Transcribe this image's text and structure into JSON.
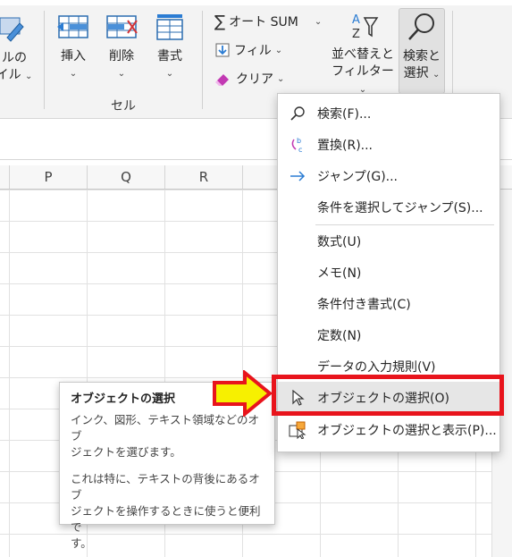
{
  "ribbon": {
    "fill_style_label_line1": "ルの",
    "fill_style_label_line2": "イル",
    "insert_label": "挿入",
    "delete_label": "削除",
    "format_label": "書式",
    "cells_group_label": "セル",
    "autosum_label": "オート SUM",
    "fill_label": "フィル",
    "clear_label": "クリア",
    "sort_filter_line1": "並べ替えと",
    "sort_filter_line2": "フィルター",
    "find_select_line1": "検索と",
    "find_select_line2": "選択"
  },
  "columns": [
    "P",
    "Q",
    "R"
  ],
  "menu": {
    "items": [
      {
        "label": "検索(F)...",
        "icon": "search-icon"
      },
      {
        "label": "置換(R)...",
        "icon": "replace-icon"
      },
      {
        "label": "ジャンプ(G)...",
        "icon": "arrow-right-icon"
      },
      {
        "label": "条件を選択してジャンプ(S)...",
        "icon": ""
      },
      {
        "label": "数式(U)",
        "icon": ""
      },
      {
        "label": "メモ(N)",
        "icon": ""
      },
      {
        "label": "条件付き書式(C)",
        "icon": ""
      },
      {
        "label": "定数(N)",
        "icon": ""
      },
      {
        "label": "データの入力規則(V)",
        "icon": ""
      },
      {
        "label": "オブジェクトの選択(O)",
        "icon": "cursor-icon"
      },
      {
        "label": "オブジェクトの選択と表示(P)...",
        "icon": "selection-pane-icon"
      }
    ]
  },
  "tooltip": {
    "title": "オブジェクトの選択",
    "line1": "インク、図形、テキスト領域などのオブ",
    "line2": "ジェクトを選びます。",
    "line3": "これは特に、テキストの背後にあるオブ",
    "line4": "ジェクトを操作するときに使うと便利で",
    "line5": "す。"
  },
  "colors": {
    "highlight_red": "#e8141c",
    "arrow_yellow": "#f7f000",
    "accent_blue": "#2b7cd3"
  }
}
